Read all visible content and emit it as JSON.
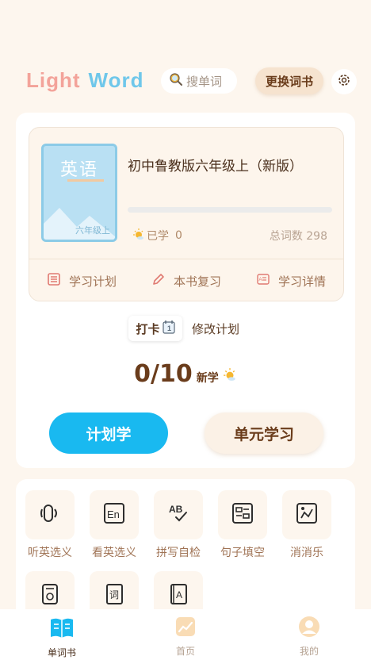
{
  "header": {
    "logo_part1": "Light",
    "logo_part2": "Word",
    "search_placeholder": "搜单词",
    "change_book": "更换词书"
  },
  "book": {
    "cover_title": "英语",
    "cover_grade": "六年级上",
    "name": "初中鲁教版六年级上（新版）",
    "progress": 0,
    "learned_label": "已学",
    "learned_count": "0",
    "total_label": "总词数",
    "total_count": "298",
    "total_text": "总词数 298"
  },
  "actions": [
    {
      "label": "学习计划",
      "icon": "list-icon"
    },
    {
      "label": "本书复习",
      "icon": "pencil-icon"
    },
    {
      "label": "学习详情",
      "icon": "detail-card-icon"
    }
  ],
  "punch": {
    "label": "打卡",
    "modify": "修改计划"
  },
  "goal": {
    "count": "0/10",
    "label": "新学"
  },
  "buttons": {
    "plan": "计划学",
    "unit": "单元学习"
  },
  "tools": [
    {
      "label": "听英选义",
      "icon": "speaker-icon"
    },
    {
      "label": "看英选义",
      "icon": "en-card-icon"
    },
    {
      "label": "拼写自检",
      "icon": "spelling-check-icon"
    },
    {
      "label": "句子填空",
      "icon": "sentence-fill-icon"
    },
    {
      "label": "消消乐",
      "icon": "puzzle-icon"
    },
    {
      "label": "",
      "icon": "audio-player-icon"
    },
    {
      "label": "",
      "icon": "vocabulary-book-icon"
    },
    {
      "label": "",
      "icon": "letter-a-book-icon"
    }
  ],
  "nav": [
    {
      "label": "单词书",
      "icon": "book-icon",
      "active": true
    },
    {
      "label": "首页",
      "icon": "chart-icon",
      "active": false
    },
    {
      "label": "我的",
      "icon": "profile-icon",
      "active": false
    }
  ],
  "colors": {
    "background": "#fdf6ee",
    "primary_blue": "#19b9f0",
    "brown_text": "#6a3c1b",
    "logo_pink": "#f3a39a",
    "logo_blue": "#6fc7ea"
  }
}
